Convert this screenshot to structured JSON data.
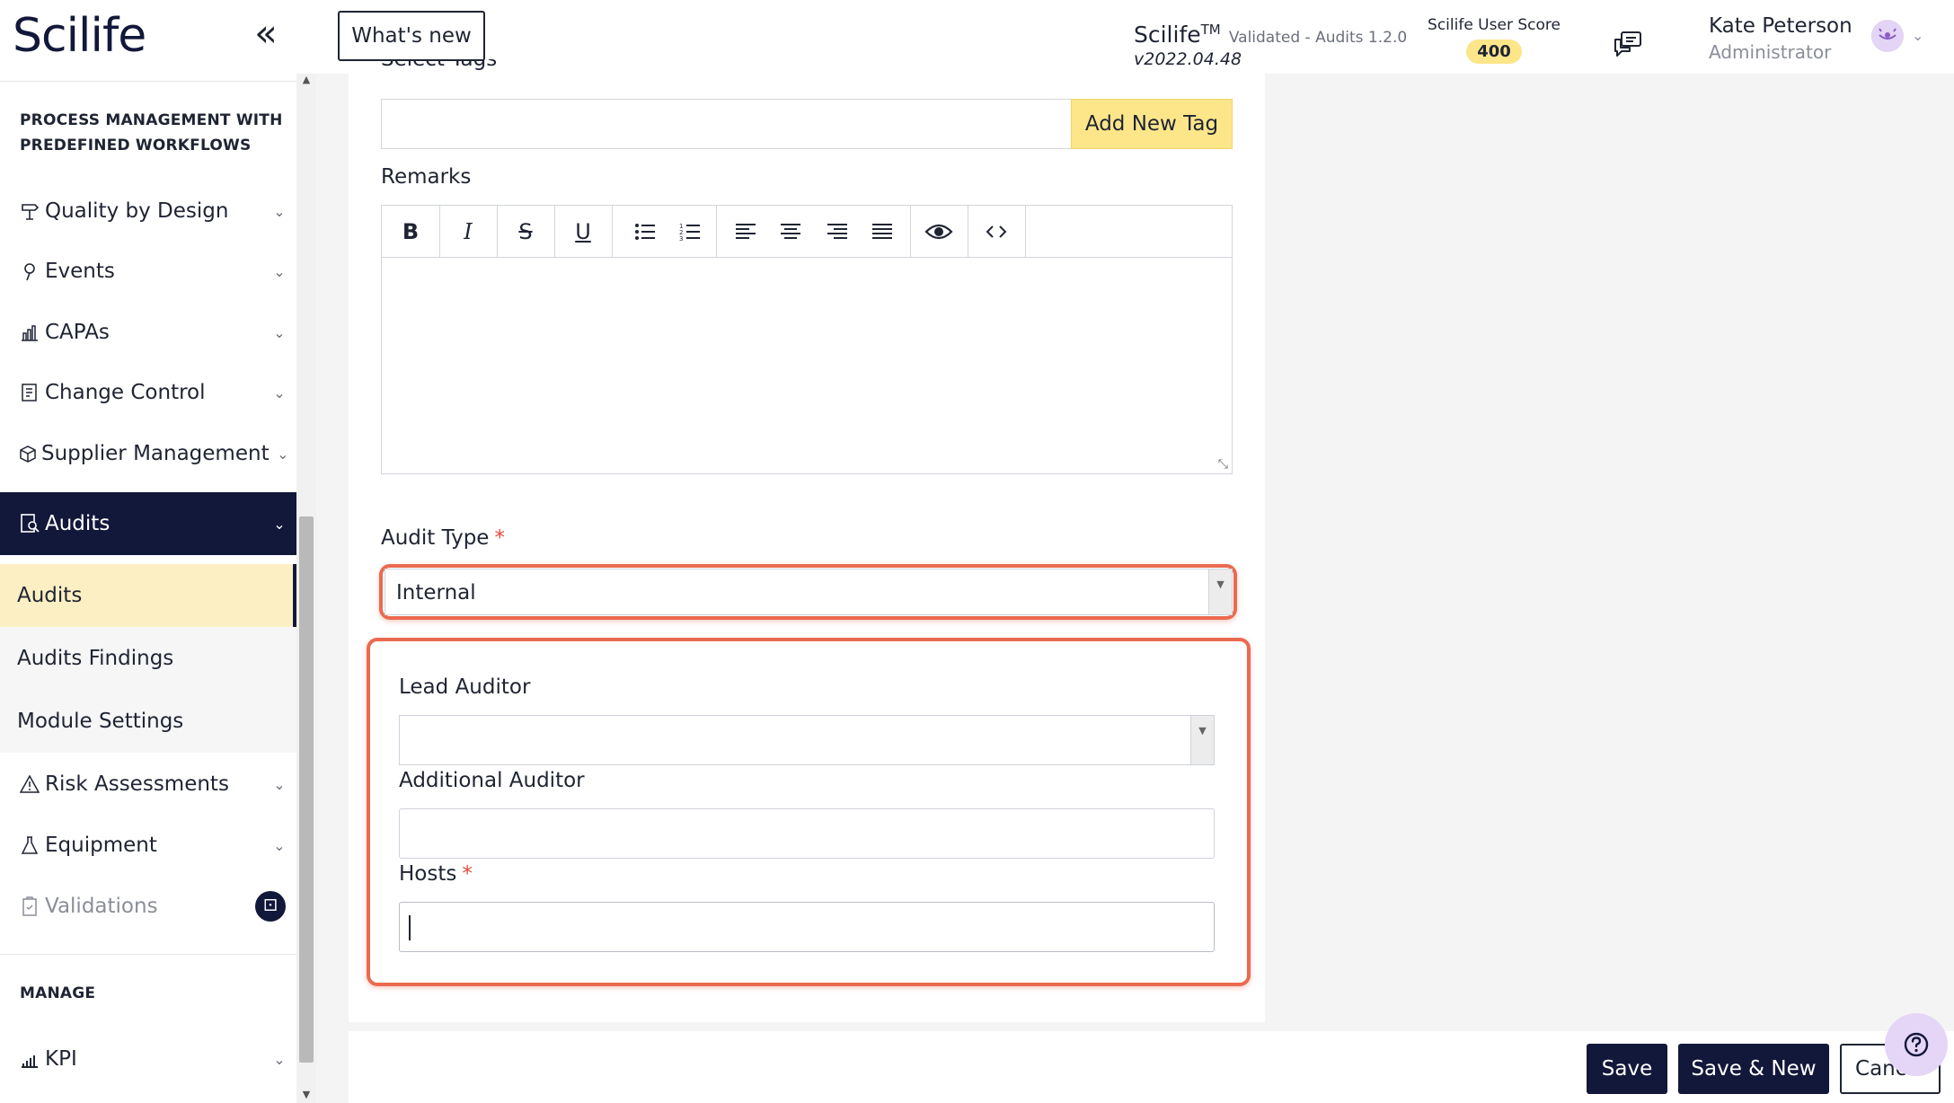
{
  "header": {
    "logo": "Scilife",
    "collapse_icon": "double-chevron-left-icon",
    "whats_new": "What's new",
    "product_name": "Scilife",
    "product_tm": "TM",
    "product_sub": "Validated - Audits 1.2.0",
    "product_version": "v2022.04.48",
    "score_label": "Scilife User Score",
    "score_value": "400",
    "user_name": "Kate Peterson",
    "user_role": "Administrator"
  },
  "sidebar": {
    "section_process_line1": "PROCESS MANAGEMENT WITH",
    "section_process_line2": "PREDEFINED WORKFLOWS",
    "items": [
      {
        "label": "Quality by Design",
        "icon": "signpost-icon"
      },
      {
        "label": "Events",
        "icon": "pin-icon"
      },
      {
        "label": "CAPAs",
        "icon": "chart-icon"
      },
      {
        "label": "Change Control",
        "icon": "document-icon"
      },
      {
        "label": "Supplier Management",
        "icon": "box-icon"
      },
      {
        "label": "Audits",
        "icon": "audit-search-icon"
      }
    ],
    "sub_items": [
      "Audits",
      "Audits Findings",
      "Module Settings"
    ],
    "items_after": [
      {
        "label": "Risk Assessments",
        "icon": "warning-icon"
      },
      {
        "label": "Equipment",
        "icon": "flask-icon"
      },
      {
        "label": "Validations",
        "icon": "clipboard-icon"
      }
    ],
    "section_manage": "MANAGE",
    "manage_items": [
      {
        "label": "KPI",
        "icon": "bar-chart-icon"
      }
    ]
  },
  "form": {
    "tags_label": "Select Tags",
    "add_tag_button": "Add New Tag",
    "remarks_label": "Remarks",
    "toolbar": {
      "bold": "B",
      "italic": "I",
      "strike": "S",
      "underline": "U"
    },
    "audit_type_label": "Audit Type",
    "audit_type_value": "Internal",
    "required_mark": "*",
    "lead_auditor_label": "Lead Auditor",
    "lead_auditor_value": "",
    "additional_auditor_label": "Additional Auditor",
    "hosts_label": "Hosts"
  },
  "footer": {
    "save": "Save",
    "save_new": "Save & New",
    "cancel": "Cancel"
  },
  "colors": {
    "brand_navy": "#12183a",
    "accent_yellow": "#fde68a",
    "highlight_orange": "#ea6a4f",
    "required_red": "#e24b3a"
  }
}
